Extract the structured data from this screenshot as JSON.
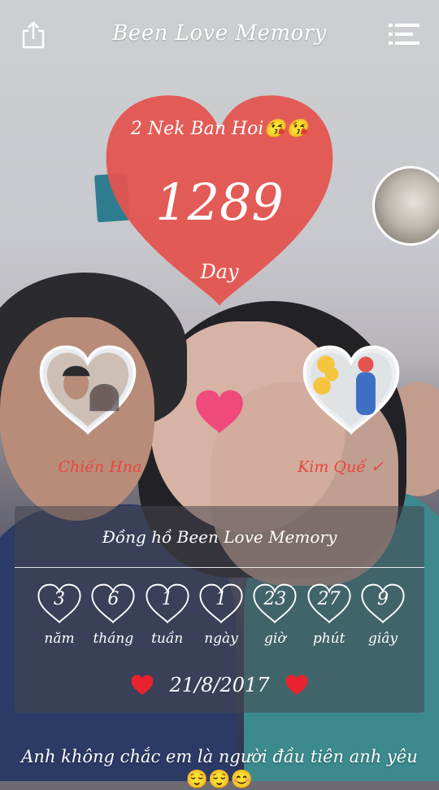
{
  "header": {
    "title": "Been Love Memory",
    "share_icon": "share-icon",
    "menu_icon": "menu-list-icon"
  },
  "couple": {
    "title": "2 Nek Ban Hoi😘😘",
    "days": "1289",
    "unit": "Day"
  },
  "people": {
    "left_name": "Chiến Hna",
    "right_name": "Kim Quế ✓"
  },
  "clock": {
    "title": "Đồng hồ Been Love Memory",
    "units": [
      {
        "value": "3",
        "label": "năm"
      },
      {
        "value": "6",
        "label": "tháng"
      },
      {
        "value": "1",
        "label": "tuần"
      },
      {
        "value": "1",
        "label": "ngày"
      },
      {
        "value": "23",
        "label": "giờ"
      },
      {
        "value": "27",
        "label": "phút"
      },
      {
        "value": "9",
        "label": "giây"
      }
    ],
    "start_date": "21/8/2017"
  },
  "caption": {
    "text": "Anh không chắc em là người đầu tiên anh yêu",
    "emoji": "😌😌😊"
  },
  "colors": {
    "heart_red": "#e4544f",
    "name_red": "#e8453d",
    "pink_heart": "#f04a7c"
  }
}
